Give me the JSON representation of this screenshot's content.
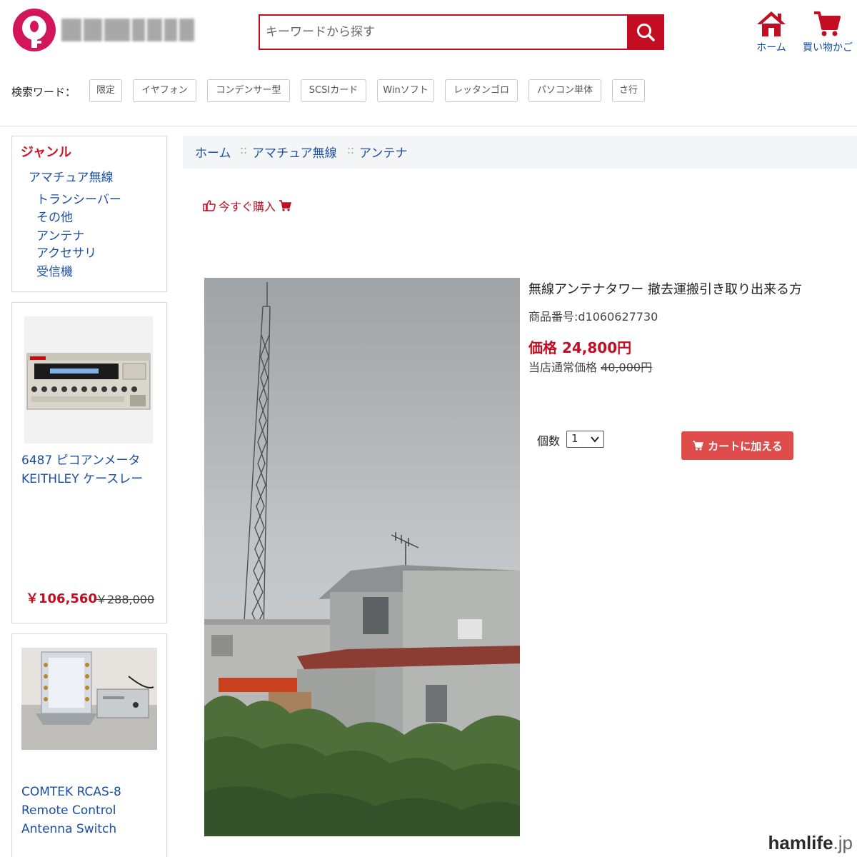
{
  "header": {
    "search_placeholder": "キーワードから探す",
    "home_label": "ホーム",
    "cart_label": "買い物かご"
  },
  "keywords": {
    "label": "検索ワード：",
    "tags": [
      "限定",
      "イヤフォン",
      "コンデンサー型",
      "SCSIカード",
      "Winソフト",
      "レッタンゴロ",
      "パソコン単体",
      "さ行"
    ]
  },
  "sidebar": {
    "genre_title": "ジャンル",
    "genre_parent": "アマチュア無線",
    "genre_children": [
      "トランシーバー",
      "その他",
      "アンテナ",
      "アクセサリ",
      "受信機"
    ],
    "products": [
      {
        "name_lines": [
          "6487 ピコアンメータ",
          "KEITHLEY ケースレー"
        ],
        "price": "￥106,560",
        "old_price": "￥288,000"
      },
      {
        "name_lines": [
          "COMTEK RCAS-8",
          "Remote Control",
          "Antenna Switch"
        ]
      }
    ]
  },
  "breadcrumb": {
    "items": [
      "ホーム",
      "アマチュア無線",
      "アンテナ"
    ],
    "separator": "::"
  },
  "product": {
    "buy_now": "今すぐ購入",
    "title": "無線アンテナタワー 撤去運搬引き取り出来る方",
    "code": "商品番号:d1060627730",
    "price": "価格 24,800円",
    "regular_label": "当店通常価格",
    "regular_price": "40,000円",
    "qty_label": "個数",
    "qty_value": "1",
    "add_cart": "カートに加える"
  },
  "watermark": {
    "brand": "hamlife",
    "tld": ".jp"
  },
  "colors": {
    "accent_red": "#c30d23",
    "link_blue": "#1a4fa3",
    "logo_pink": "#d3155c",
    "button_red": "#dd4b4b"
  }
}
